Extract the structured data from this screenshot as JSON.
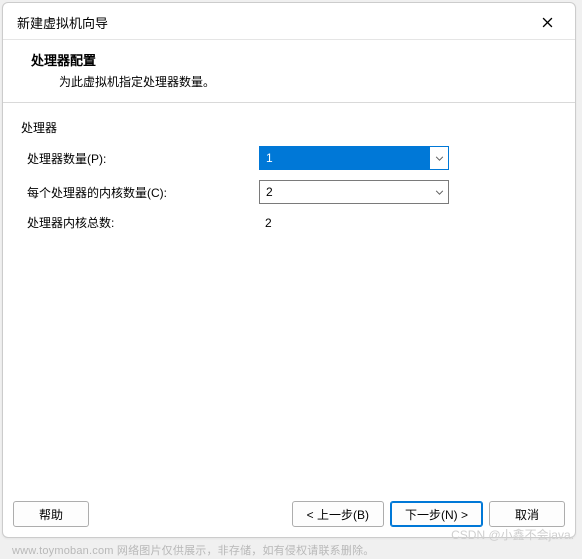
{
  "titlebar": {
    "title": "新建虚拟机向导"
  },
  "header": {
    "title": "处理器配置",
    "subtitle": "为此虚拟机指定处理器数量。"
  },
  "group": {
    "label": "处理器"
  },
  "fields": {
    "processor_count": {
      "label": "处理器数量(P):",
      "value": "1"
    },
    "cores_per_processor": {
      "label": "每个处理器的内核数量(C):",
      "value": "2"
    },
    "total_cores": {
      "label": "处理器内核总数:",
      "value": "2"
    }
  },
  "footer": {
    "help": "帮助",
    "back": "< 上一步(B)",
    "next": "下一步(N) >",
    "cancel": "取消"
  },
  "watermark": {
    "left": "www.toymoban.com 网络图片仅供展示，非存储，如有侵权请联系删除。",
    "right": "CSDN @小鑫不会java."
  }
}
